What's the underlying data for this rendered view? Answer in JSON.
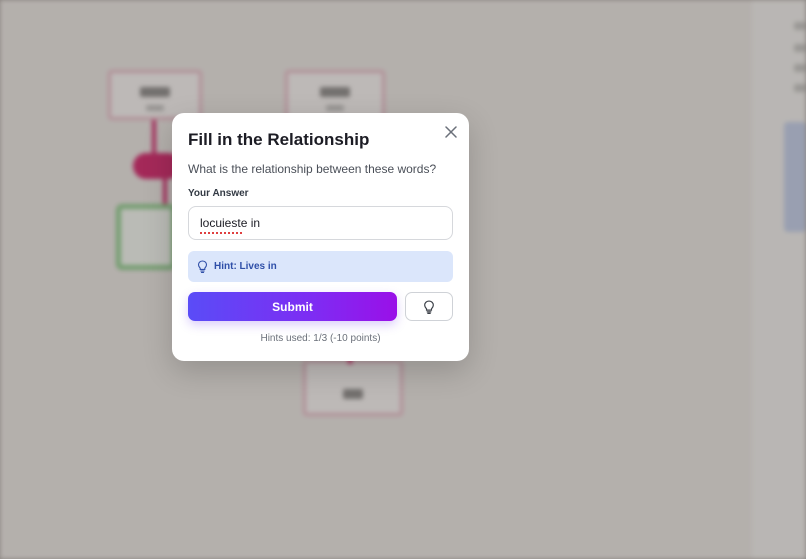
{
  "modal": {
    "title": "Fill in the Relationship",
    "question": "What is the relationship between these words?",
    "answer_label": "Your Answer",
    "answer_value": "locuieste in",
    "hint_text": "Hint: Lives in",
    "submit_label": "Submit",
    "hints_used": "Hints used: 1/3 (-10 points)"
  },
  "icons": {
    "close": "close-icon",
    "hint": "lightbulb-icon",
    "hint_button": "lightbulb-icon"
  },
  "colors": {
    "accent_start": "#5a4cf7",
    "accent_end": "#9a10e8",
    "hint_bg": "#dbe6fb",
    "hint_text": "#2f4fa8"
  }
}
